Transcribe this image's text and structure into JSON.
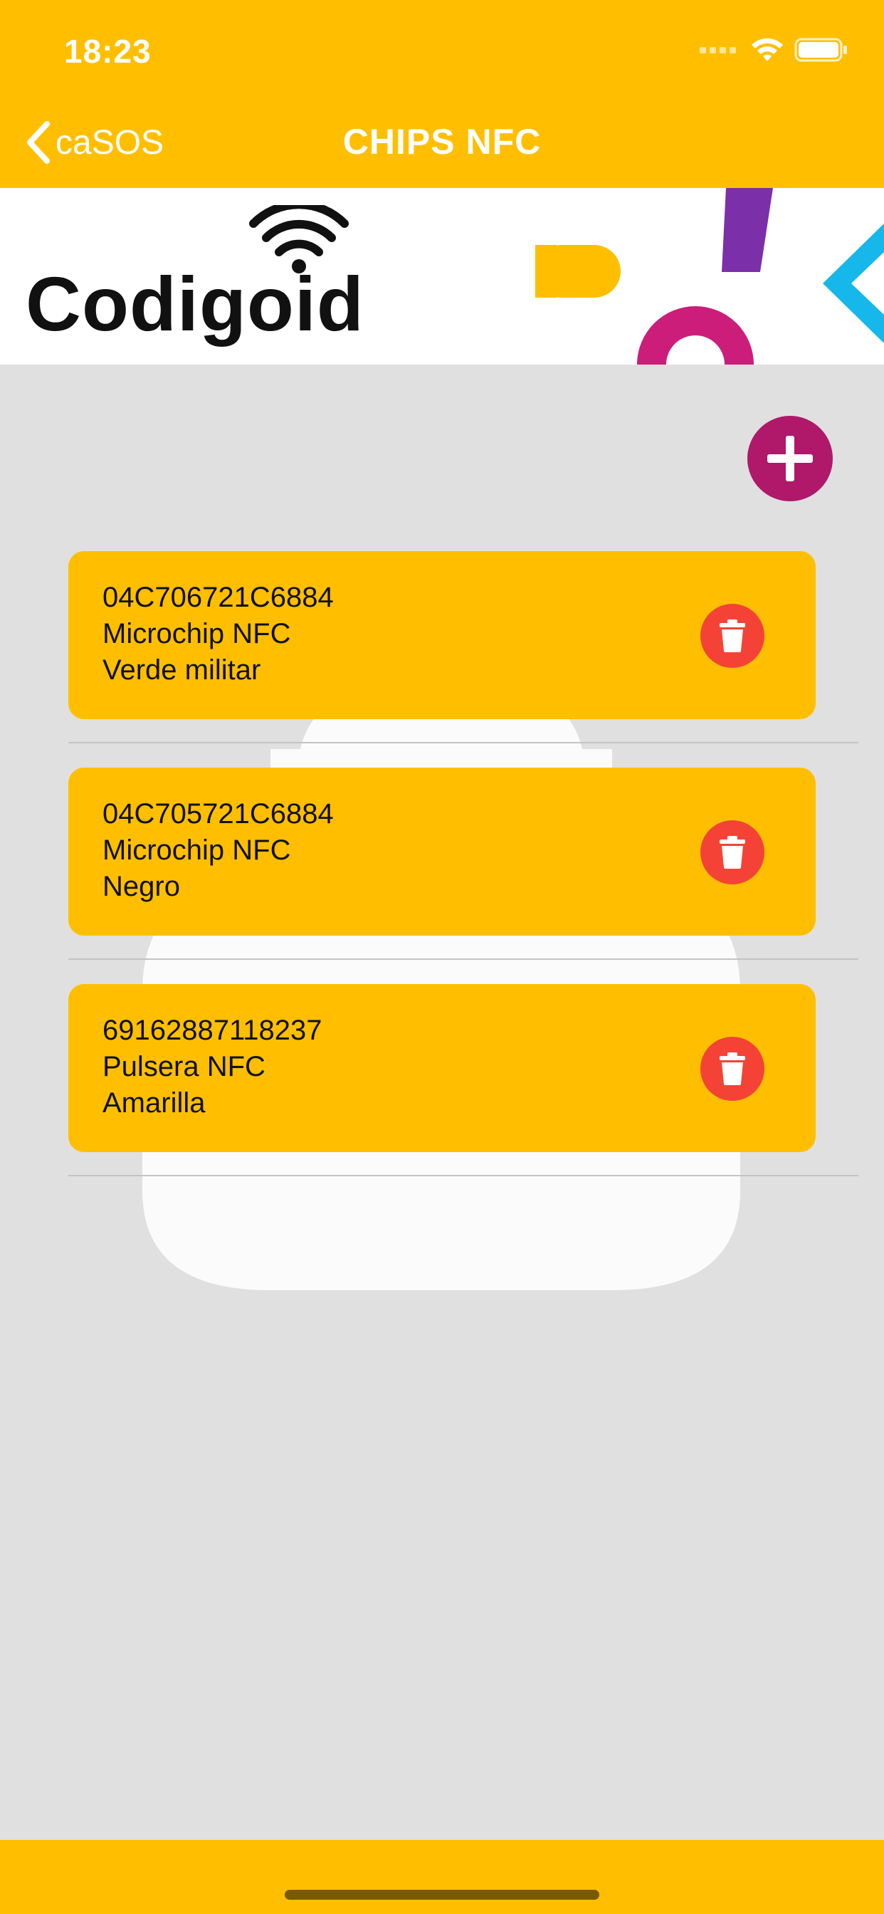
{
  "status": {
    "time": "18:23"
  },
  "nav": {
    "back_label": "caSOS",
    "title": "CHIPS NFC"
  },
  "banner": {
    "logo_text": "Codigoid"
  },
  "colors": {
    "primary": "#ffbf00",
    "accent": "#b0186a",
    "danger": "#f44336"
  },
  "chips": [
    {
      "code": "04C706721C6884",
      "type": "Microchip NFC",
      "color": "Verde militar"
    },
    {
      "code": "04C705721C6884",
      "type": "Microchip NFC",
      "color": "Negro"
    },
    {
      "code": "69162887118237",
      "type": "Pulsera NFC",
      "color": "Amarilla"
    }
  ],
  "icons": {
    "add": "plus-icon",
    "delete": "trash-icon",
    "back": "chevron-left-icon"
  }
}
